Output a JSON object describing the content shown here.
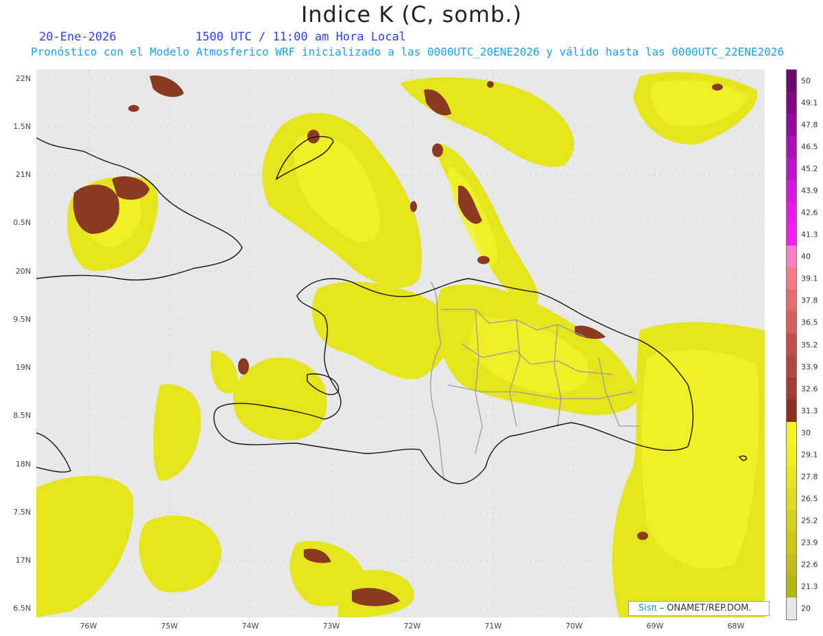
{
  "title": "Indice K (C, somb.)",
  "date_text": "20-Ene-2026",
  "time_text": "1500 UTC / 11:00 am Hora Local",
  "subtitle": "Pronóstico con el Modelo Atmosferico WRF inicializado a las 0000UTC_20ENE2026 y válido hasta las  0000UTC_22ENE2026",
  "lat_labels": [
    "22N",
    "1.5N",
    "21N",
    "0.5N",
    "20N",
    "9.5N",
    "19N",
    "8.5N",
    "18N",
    "7.5N",
    "17N",
    "6.5N"
  ],
  "lon_labels": [
    "76W",
    "75W",
    "74W",
    "73W",
    "72W",
    "71W",
    "70W",
    "69W",
    "68W"
  ],
  "colorbar": {
    "levels": [
      "50",
      "49.1",
      "47.8",
      "46.5",
      "45.2",
      "43.9",
      "42.6",
      "41.3",
      "40",
      "39.1",
      "37.8",
      "36.5",
      "35.2",
      "33.9",
      "32.6",
      "31.3",
      "30",
      "29.1",
      "27.8",
      "26.5",
      "25.2",
      "23.9",
      "22.6",
      "21.3",
      "20"
    ],
    "colors": [
      "#6a0a6e",
      "#7e0a85",
      "#940a9c",
      "#a810b2",
      "#be14c8",
      "#d418dc",
      "#e61ae8",
      "#f21ef2",
      "#ff80c0",
      "#f47a84",
      "#e06c6c",
      "#d0605c",
      "#c05050",
      "#b04842",
      "#a03c34",
      "#8a3022",
      "#f5f51e",
      "#eeee22",
      "#e6e624",
      "#dcdc22",
      "#d2d21e",
      "#c8c81a",
      "#bebe16",
      "#b4b412"
    ],
    "below_color": "#e6e6e6"
  },
  "credit": {
    "brand": "SisPi",
    "symbol": "π",
    "prefix": "Sis",
    "rest": "– ONAMET/REP.DOM."
  },
  "colors": {
    "shade_low": "#d8d81e",
    "shade_mid": "#eded22",
    "shade_high": "#f5f52a",
    "core": "#8a3a22",
    "land": "#e8e8e8",
    "border": "#999999",
    "coast": "#111111"
  }
}
